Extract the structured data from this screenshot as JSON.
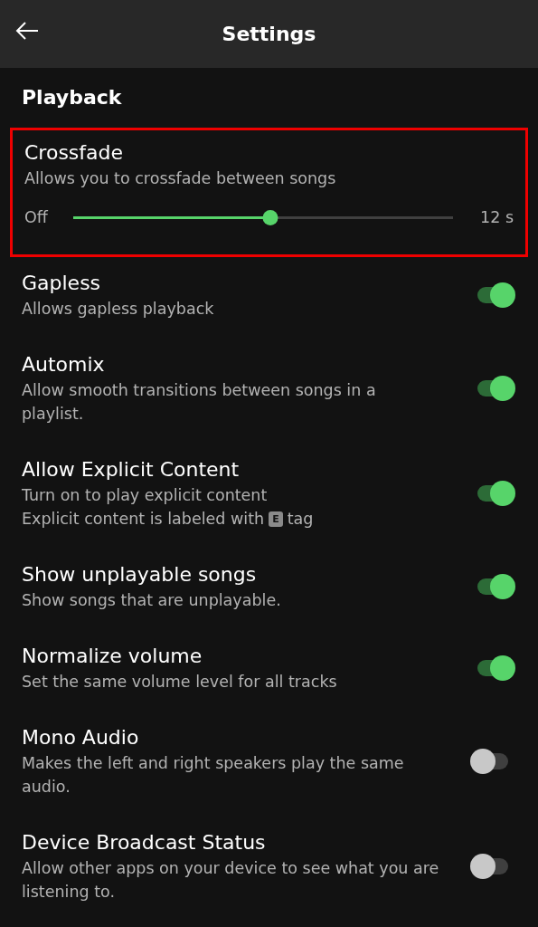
{
  "header": {
    "title": "Settings"
  },
  "section": {
    "title": "Playback"
  },
  "settings": [
    {
      "kind": "slider",
      "title": "Crossfade",
      "description": "Allows you to crossfade between songs",
      "highlighted": true,
      "min_label": "Off",
      "max_label": "12 s",
      "level": 0.5
    },
    {
      "kind": "toggle",
      "title": "Gapless",
      "description": "Allows gapless playback",
      "on": true
    },
    {
      "kind": "toggle",
      "title": "Automix",
      "description": "Allow smooth transitions between songs in a playlist.",
      "on": true
    },
    {
      "kind": "toggle",
      "title": "Allow Explicit Content",
      "description": "Turn on to play explicit content",
      "note": {
        "before": "Explicit content is labeled with",
        "tag": "E",
        "after": "tag"
      },
      "on": true
    },
    {
      "kind": "toggle",
      "title": "Show unplayable songs",
      "description": "Show songs that are unplayable.",
      "on": true
    },
    {
      "kind": "toggle",
      "title": "Normalize volume",
      "description": "Set the same volume level for all tracks",
      "on": true
    },
    {
      "kind": "toggle",
      "title": "Mono Audio",
      "description": "Makes the left and right speakers play the same audio.",
      "on": false
    },
    {
      "kind": "toggle",
      "title": "Device Broadcast Status",
      "description": "Allow other apps on your device to see what you are listening to.",
      "on": false
    }
  ]
}
